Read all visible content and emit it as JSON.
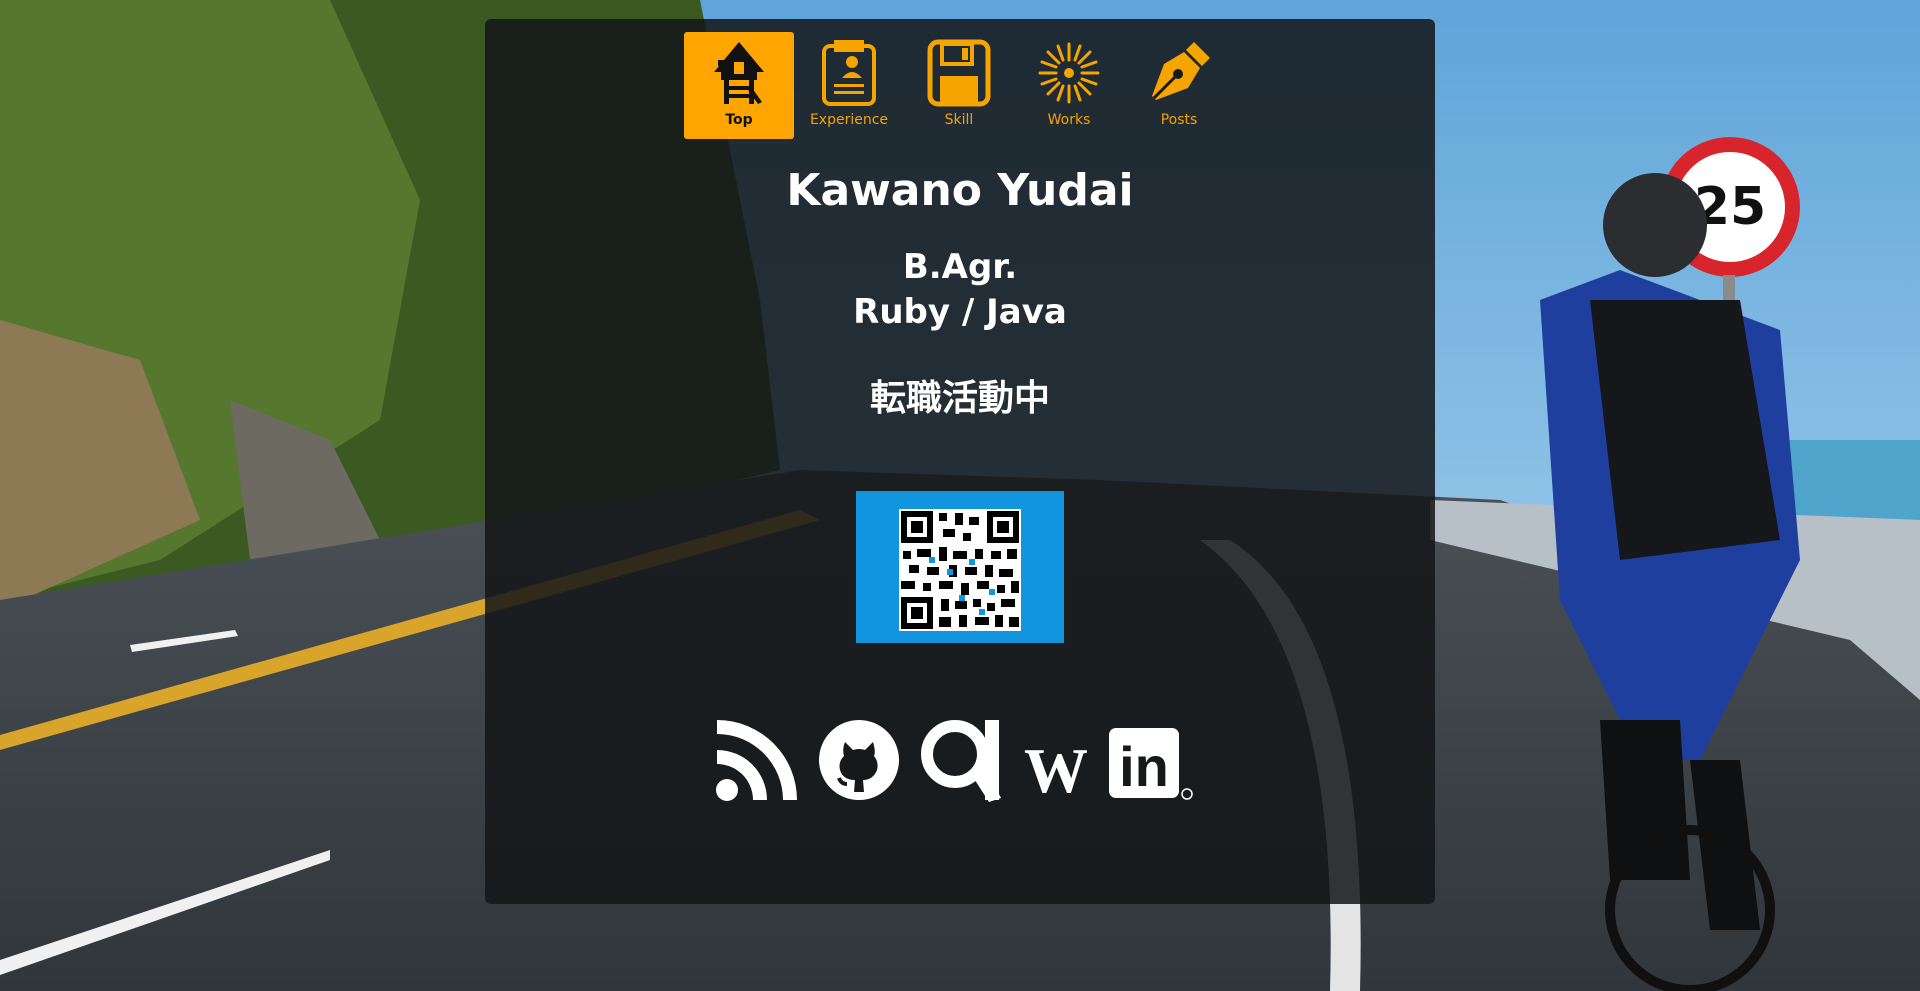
{
  "nav": {
    "items": [
      {
        "label": "Top",
        "icon": "house-icon",
        "active": true
      },
      {
        "label": "Experience",
        "icon": "resume-document-icon"
      },
      {
        "label": "Skill",
        "icon": "floppy-disk-icon"
      },
      {
        "label": "Works",
        "icon": "fireworks-icon"
      },
      {
        "label": "Posts",
        "icon": "fountain-pen-icon"
      }
    ]
  },
  "profile": {
    "name": "Kawano Yudai",
    "degree": "B.Agr.",
    "languages": "Ruby / Java",
    "status": "転職活動中"
  },
  "qr": {
    "icon": "qr-code-icon",
    "background": "#1195de"
  },
  "social": [
    {
      "icon": "rss-feed-icon"
    },
    {
      "icon": "github-icon"
    },
    {
      "icon": "qiita-search-icon"
    },
    {
      "icon": "wantedly-icon",
      "label": "W"
    },
    {
      "icon": "linkedin-icon",
      "label": "in"
    }
  ],
  "colors": {
    "accent": "#ffa500",
    "card": "#16181a",
    "qr": "#1195de"
  }
}
